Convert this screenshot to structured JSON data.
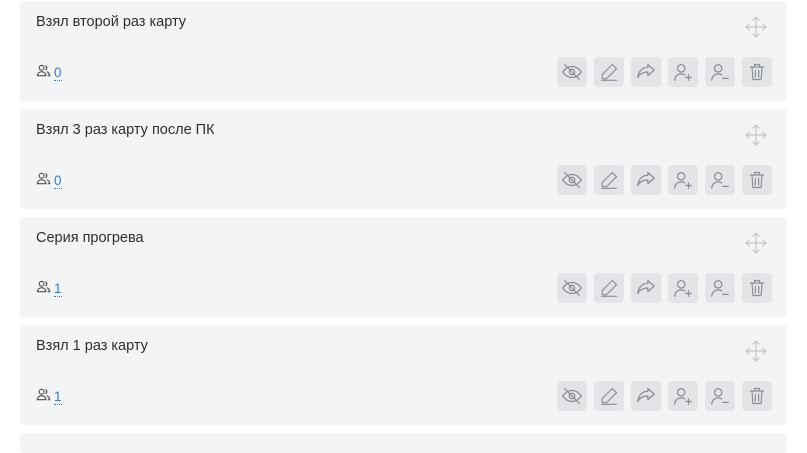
{
  "cards": [
    {
      "title": "Взял второй раз карту",
      "subscribers": "0"
    },
    {
      "title": "Взял 3 раз карту после ПК",
      "subscribers": "0"
    },
    {
      "title": "Серия прогрева",
      "subscribers": "1"
    },
    {
      "title": "Взял 1 раз карту",
      "subscribers": "1"
    }
  ],
  "icons": {
    "move": "move-arrows-icon",
    "subscribers": "users-icon",
    "actions": [
      "eye-off-icon",
      "pencil-icon",
      "share-arrow-icon",
      "user-plus-icon",
      "user-minus-icon",
      "trash-icon"
    ]
  },
  "colors": {
    "card_bg": "#f3f4f6",
    "button_bg": "#e2e4e7",
    "icon": "#8a8f96",
    "count_link": "#3a7bbf"
  }
}
